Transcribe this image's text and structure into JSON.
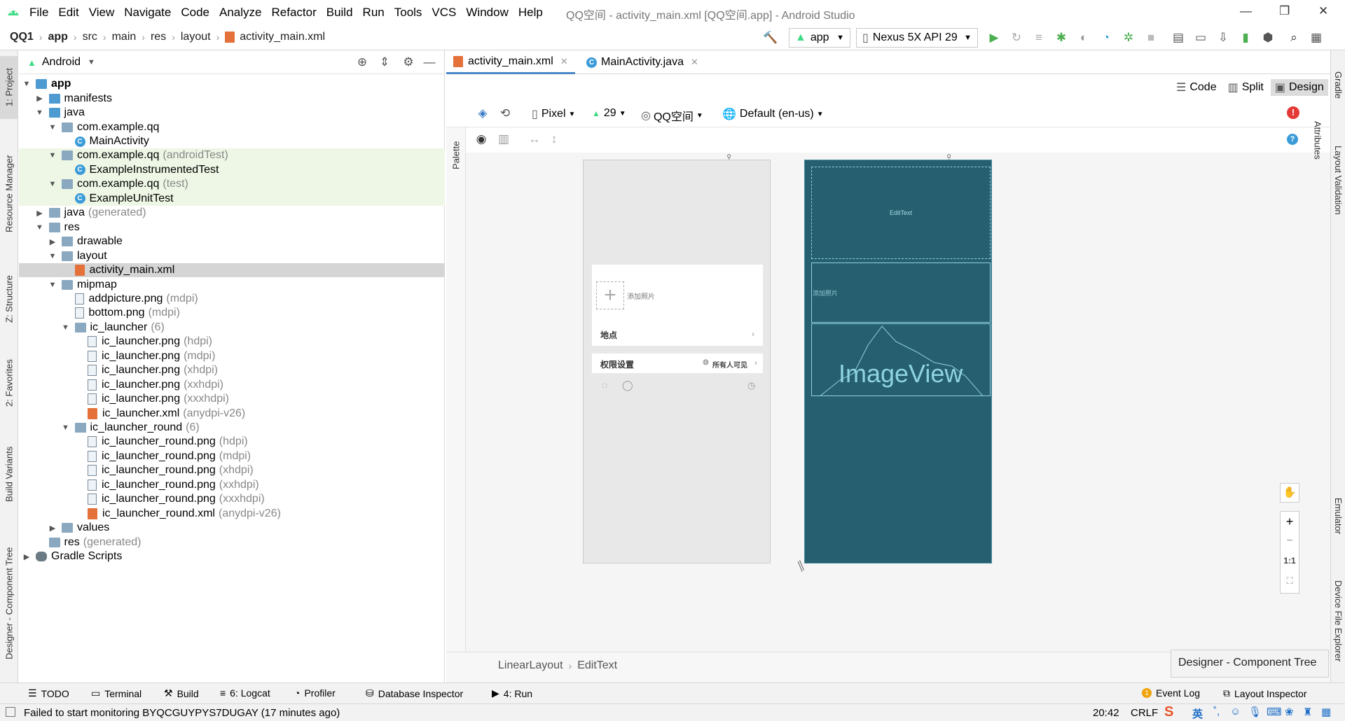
{
  "window": {
    "title": "QQ空间 - activity_main.xml [QQ空间.app] - Android Studio",
    "menu": [
      "File",
      "Edit",
      "View",
      "Navigate",
      "Code",
      "Analyze",
      "Refactor",
      "Build",
      "Run",
      "Tools",
      "VCS",
      "Window",
      "Help"
    ]
  },
  "breadcrumb": [
    "QQ1",
    "app",
    "src",
    "main",
    "res",
    "layout",
    "activity_main.xml"
  ],
  "toolbar": {
    "run_config": "app",
    "device": "Nexus 5X API 29"
  },
  "left_strip": [
    "1: Project",
    "Resource Manager",
    "Z: Structure",
    "2: Favorites",
    "Build Variants",
    "Designer - Component Tree"
  ],
  "project_panel": {
    "view_mode": "Android",
    "tree": [
      {
        "label": "app",
        "suffix": "",
        "depth": 0,
        "arrow": "down",
        "icon": "module",
        "bold": true
      },
      {
        "label": "manifests",
        "suffix": "",
        "depth": 1,
        "arrow": "right",
        "icon": "folder-blue"
      },
      {
        "label": "java",
        "suffix": "",
        "depth": 1,
        "arrow": "down",
        "icon": "folder-blue"
      },
      {
        "label": "com.example.qq",
        "suffix": "",
        "depth": 2,
        "arrow": "down",
        "icon": "package"
      },
      {
        "label": "MainActivity",
        "suffix": "",
        "depth": 3,
        "arrow": "",
        "icon": "class"
      },
      {
        "label": "com.example.qq",
        "suffix": "(androidTest)",
        "depth": 2,
        "arrow": "down",
        "icon": "package",
        "highlight": true
      },
      {
        "label": "ExampleInstrumentedTest",
        "suffix": "",
        "depth": 3,
        "arrow": "",
        "icon": "class",
        "highlight": true
      },
      {
        "label": "com.example.qq",
        "suffix": "(test)",
        "depth": 2,
        "arrow": "down",
        "icon": "package",
        "highlight": true
      },
      {
        "label": "ExampleUnitTest",
        "suffix": "",
        "depth": 3,
        "arrow": "",
        "icon": "class",
        "highlight": true
      },
      {
        "label": "java",
        "suffix": "(generated)",
        "depth": 1,
        "arrow": "right",
        "icon": "folder"
      },
      {
        "label": "res",
        "suffix": "",
        "depth": 1,
        "arrow": "down",
        "icon": "folder"
      },
      {
        "label": "drawable",
        "suffix": "",
        "depth": 2,
        "arrow": "right",
        "icon": "folder"
      },
      {
        "label": "layout",
        "suffix": "",
        "depth": 2,
        "arrow": "down",
        "icon": "folder"
      },
      {
        "label": "activity_main.xml",
        "suffix": "",
        "depth": 3,
        "arrow": "",
        "icon": "xml",
        "selected": true
      },
      {
        "label": "mipmap",
        "suffix": "",
        "depth": 2,
        "arrow": "down",
        "icon": "folder"
      },
      {
        "label": "addpicture.png",
        "suffix": "(mdpi)",
        "depth": 3,
        "arrow": "",
        "icon": "file"
      },
      {
        "label": "bottom.png",
        "suffix": "(mdpi)",
        "depth": 3,
        "arrow": "",
        "icon": "file"
      },
      {
        "label": "ic_launcher",
        "suffix": "(6)",
        "depth": 3,
        "arrow": "down",
        "icon": "folder"
      },
      {
        "label": "ic_launcher.png",
        "suffix": "(hdpi)",
        "depth": 4,
        "arrow": "",
        "icon": "file"
      },
      {
        "label": "ic_launcher.png",
        "suffix": "(mdpi)",
        "depth": 4,
        "arrow": "",
        "icon": "file"
      },
      {
        "label": "ic_launcher.png",
        "suffix": "(xhdpi)",
        "depth": 4,
        "arrow": "",
        "icon": "file"
      },
      {
        "label": "ic_launcher.png",
        "suffix": "(xxhdpi)",
        "depth": 4,
        "arrow": "",
        "icon": "file"
      },
      {
        "label": "ic_launcher.png",
        "suffix": "(xxxhdpi)",
        "depth": 4,
        "arrow": "",
        "icon": "file"
      },
      {
        "label": "ic_launcher.xml",
        "suffix": "(anydpi-v26)",
        "depth": 4,
        "arrow": "",
        "icon": "xml"
      },
      {
        "label": "ic_launcher_round",
        "suffix": "(6)",
        "depth": 3,
        "arrow": "down",
        "icon": "folder"
      },
      {
        "label": "ic_launcher_round.png",
        "suffix": "(hdpi)",
        "depth": 4,
        "arrow": "",
        "icon": "file"
      },
      {
        "label": "ic_launcher_round.png",
        "suffix": "(mdpi)",
        "depth": 4,
        "arrow": "",
        "icon": "file"
      },
      {
        "label": "ic_launcher_round.png",
        "suffix": "(xhdpi)",
        "depth": 4,
        "arrow": "",
        "icon": "file"
      },
      {
        "label": "ic_launcher_round.png",
        "suffix": "(xxhdpi)",
        "depth": 4,
        "arrow": "",
        "icon": "file"
      },
      {
        "label": "ic_launcher_round.png",
        "suffix": "(xxxhdpi)",
        "depth": 4,
        "arrow": "",
        "icon": "file"
      },
      {
        "label": "ic_launcher_round.xml",
        "suffix": "(anydpi-v26)",
        "depth": 4,
        "arrow": "",
        "icon": "xml"
      },
      {
        "label": "values",
        "suffix": "",
        "depth": 2,
        "arrow": "right",
        "icon": "folder"
      },
      {
        "label": "res",
        "suffix": "(generated)",
        "depth": 1,
        "arrow": "",
        "icon": "folder"
      },
      {
        "label": "Gradle Scripts",
        "suffix": "",
        "depth": 0,
        "arrow": "right",
        "icon": "gradle"
      }
    ]
  },
  "editor": {
    "tabs": [
      {
        "label": "activity_main.xml",
        "active": true
      },
      {
        "label": "MainActivity.java",
        "active": false
      }
    ],
    "modes": [
      "Code",
      "Split",
      "Design"
    ],
    "palette_label": "Palette",
    "canvas_bar": {
      "device": "Pixel",
      "api": "29",
      "theme": "QQ空间",
      "locale": "Default (en-us)"
    },
    "design_preview": {
      "add_photo": "添加照片",
      "location": "地点",
      "permission": "权限设置",
      "visibility": "所有人可见"
    },
    "blueprint": {
      "edittext": "EditText",
      "add_photo": "添加照片",
      "imageview": "ImageView"
    },
    "zoom": {
      "fit": "1:1"
    },
    "component_path": [
      "LinearLayout",
      "EditText"
    ],
    "component_tree_tooltip": "Designer - Component Tree"
  },
  "right_strip": [
    "Gradle",
    "Layout Validation",
    "Attributes",
    "Emulator",
    "Device File Explorer"
  ],
  "tool_windows": [
    {
      "label": "TODO"
    },
    {
      "label": "Terminal"
    },
    {
      "label": "Build"
    },
    {
      "label": "6: Logcat"
    },
    {
      "label": "Profiler"
    },
    {
      "label": "Database Inspector"
    },
    {
      "label": "4: Run"
    }
  ],
  "tool_windows_right": [
    {
      "label": "Event Log",
      "badge": "1"
    },
    {
      "label": "Layout Inspector"
    }
  ],
  "status": {
    "message": "Failed to start monitoring BYQCGUYPYS7DUGAY (17 minutes ago)",
    "position": "20:42",
    "line_ending": "CRLF",
    "ime": "英"
  }
}
